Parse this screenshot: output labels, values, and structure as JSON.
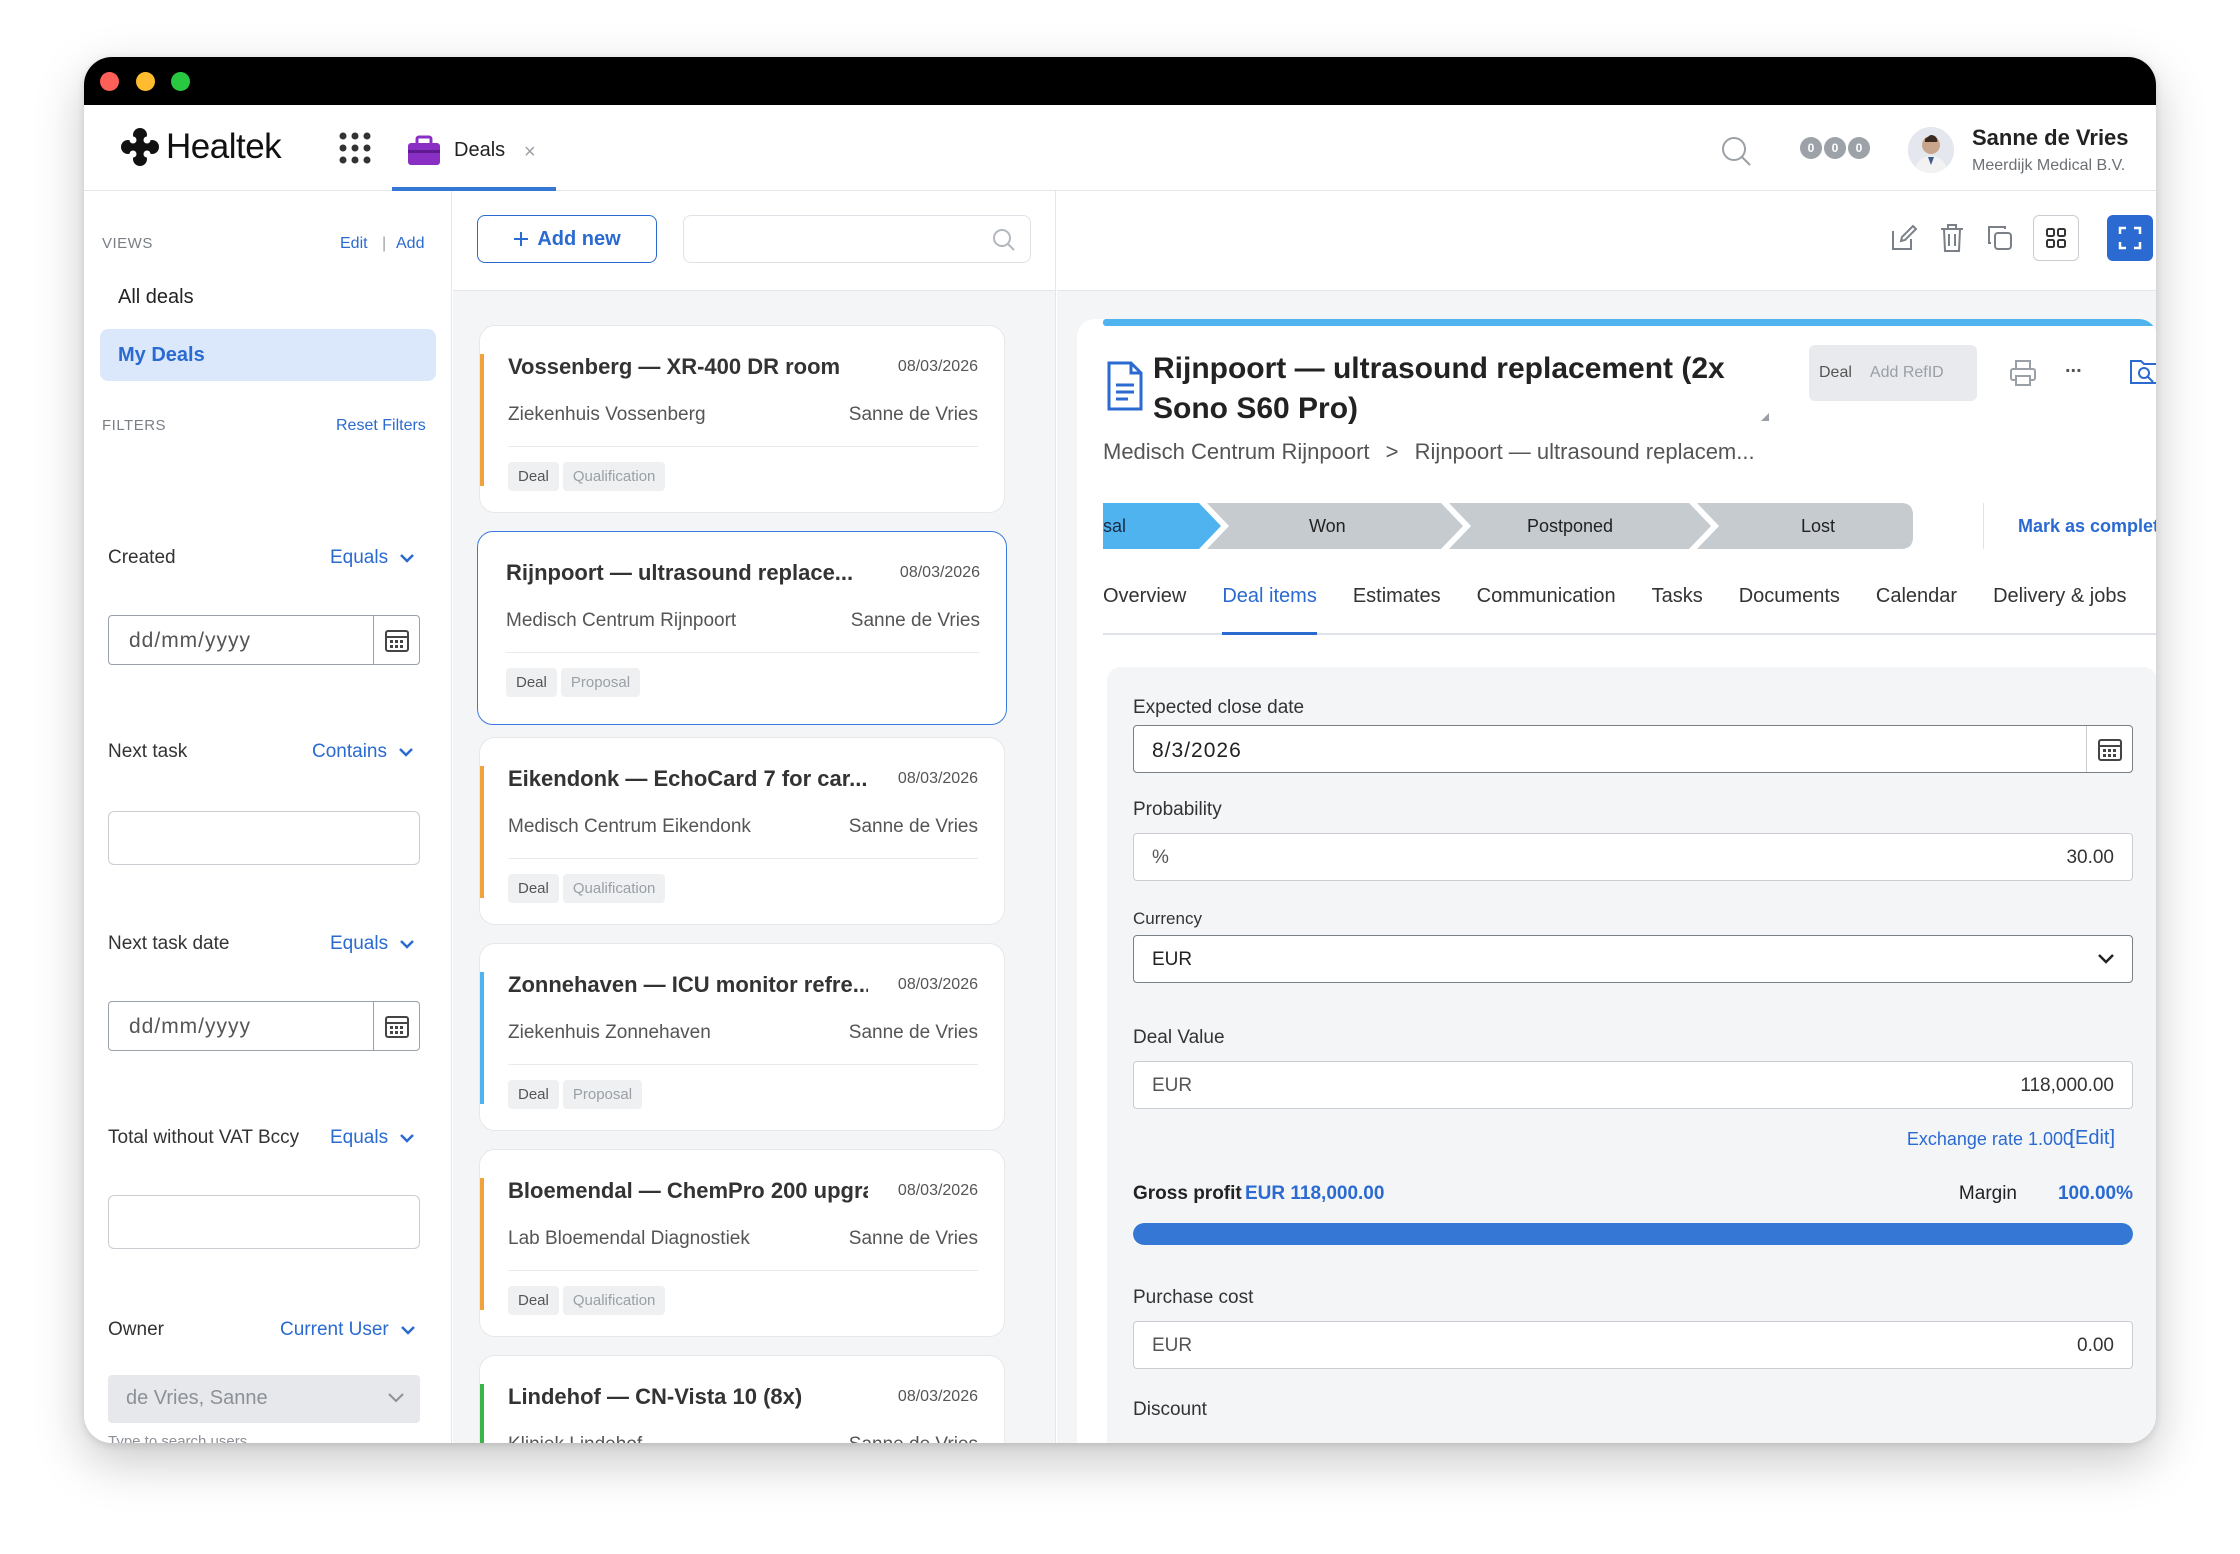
{
  "app": {
    "name": "Healtek",
    "tab_label": "Deals",
    "tab_close": "×"
  },
  "user": {
    "name": "Sanne de Vries",
    "org": "Meerdijk Medical B.V.",
    "status_dots": [
      "0",
      "0",
      "0"
    ]
  },
  "sidebar": {
    "views_heading": "VIEWS",
    "edit": "Edit",
    "sep": "|",
    "add": "Add",
    "items": [
      {
        "label": "All deals"
      },
      {
        "label": "My Deals"
      }
    ],
    "filters_heading": "FILTERS",
    "reset": "Reset Filters",
    "filters": [
      {
        "label": "Created",
        "op": "Equals",
        "value": "dd/mm/yyyy"
      },
      {
        "label": "Next task",
        "op": "Contains",
        "value": ""
      },
      {
        "label": "Next task date",
        "op": "Equals",
        "value": "dd/mm/yyyy"
      },
      {
        "label": "Total without VAT Bccy",
        "op": "Equals",
        "value": ""
      },
      {
        "label": "Owner",
        "op": "Current User",
        "value": "de Vries, Sanne",
        "hint": "Type to search users..."
      }
    ]
  },
  "list": {
    "add_new": "Add new",
    "search_placeholder": "",
    "cards": [
      {
        "title": "Vossenberg — XR-400 DR room",
        "date": "08/03/2026",
        "org": "Ziekenhuis Vossenberg",
        "owner": "Sanne de Vries",
        "tag1": "Deal",
        "tag2": "Qualification",
        "color": "#f0a33c"
      },
      {
        "title": "Rijnpoort — ultrasound replace...",
        "date": "08/03/2026",
        "org": "Medisch Centrum Rijnpoort",
        "owner": "Sanne de Vries",
        "tag1": "Deal",
        "tag2": "Proposal",
        "color": ""
      },
      {
        "title": "Eikendonk — EchoCard 7 for car...",
        "date": "08/03/2026",
        "org": "Medisch Centrum Eikendonk",
        "owner": "Sanne de Vries",
        "tag1": "Deal",
        "tag2": "Qualification",
        "color": "#f0a33c"
      },
      {
        "title": "Zonnehaven — ICU monitor refre...",
        "date": "08/03/2026",
        "org": "Ziekenhuis Zonnehaven",
        "owner": "Sanne de Vries",
        "tag1": "Deal",
        "tag2": "Proposal",
        "color": "#4fb3f0"
      },
      {
        "title": "Bloemendal — ChemPro 200 upgra...",
        "date": "08/03/2026",
        "org": "Lab Bloemendal Diagnostiek",
        "owner": "Sanne de Vries",
        "tag1": "Deal",
        "tag2": "Qualification",
        "color": "#f0a33c"
      },
      {
        "title": "Lindehof — CN-Vista 10 (8x)",
        "date": "08/03/2026",
        "org": "Kliniek Lindehof",
        "owner": "Sanne de Vries",
        "tag1": "",
        "tag2": "",
        "color": "#3bb54a"
      }
    ]
  },
  "detail": {
    "title": "Rijnpoort — ultrasound replacement (2x Sono S60 Pro)",
    "pill_type": "Deal",
    "pill_ref": "Add RefID",
    "more": "...",
    "breadcrumb": {
      "org": "Medisch Centrum Rijnpoort",
      "sep": ">",
      "deal": "Rijnpoort — ultrasound replacem..."
    },
    "stages": [
      "sal",
      "Won",
      "Postponed",
      "Lost"
    ],
    "mark_complete": "Mark as completed",
    "tabs": [
      "Overview",
      "Deal items",
      "Estimates",
      "Communication",
      "Tasks",
      "Documents",
      "Calendar",
      "Delivery & jobs"
    ],
    "active_tab": "Deal items",
    "form": {
      "close_label": "Expected close date",
      "close_value": "8/3/2026",
      "prob_label": "Probability",
      "prob_prefix": "%",
      "prob_value": "30.00",
      "currency_label": "Currency",
      "currency_value": "EUR",
      "deal_value_label": "Deal Value",
      "deal_value_prefix": "EUR",
      "deal_value": "118,000.00",
      "exchange": "Exchange rate 1.000",
      "exchange_edit": "[Edit]",
      "gross_label": "Gross profit",
      "gross_value": "EUR 118,000.00",
      "margin_label": "Margin",
      "margin_value": "100.00%",
      "margin_fraction": 1.0,
      "purchase_label": "Purchase cost",
      "purchase_prefix": "EUR",
      "purchase_value": "0.00",
      "discount_label": "Discount"
    }
  },
  "colors": {
    "accent": "#2a6ad1",
    "stage_active": "#4fb3f0",
    "stage_inactive": "#c6cbd0"
  }
}
